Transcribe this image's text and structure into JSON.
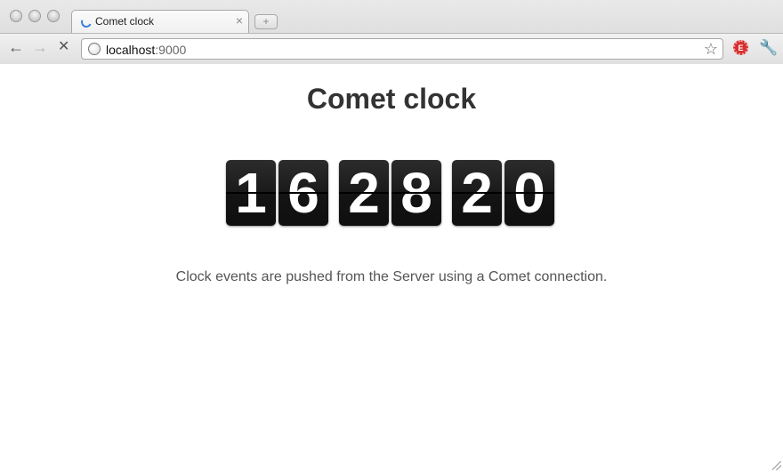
{
  "browser": {
    "tab": {
      "title": "Comet clock",
      "close": "×"
    },
    "new_tab": "+",
    "nav": {
      "back": "←",
      "forward": "→",
      "stop": "✕"
    },
    "url": {
      "host": "localhost",
      "port": ":9000"
    },
    "star": "☆",
    "wrench": "🔧",
    "extension_label": "E"
  },
  "page": {
    "title": "Comet clock",
    "clock": {
      "digits": [
        "1",
        "6",
        "2",
        "8",
        "2",
        "0"
      ]
    },
    "caption": "Clock events are pushed from the Server using a Comet connection."
  }
}
